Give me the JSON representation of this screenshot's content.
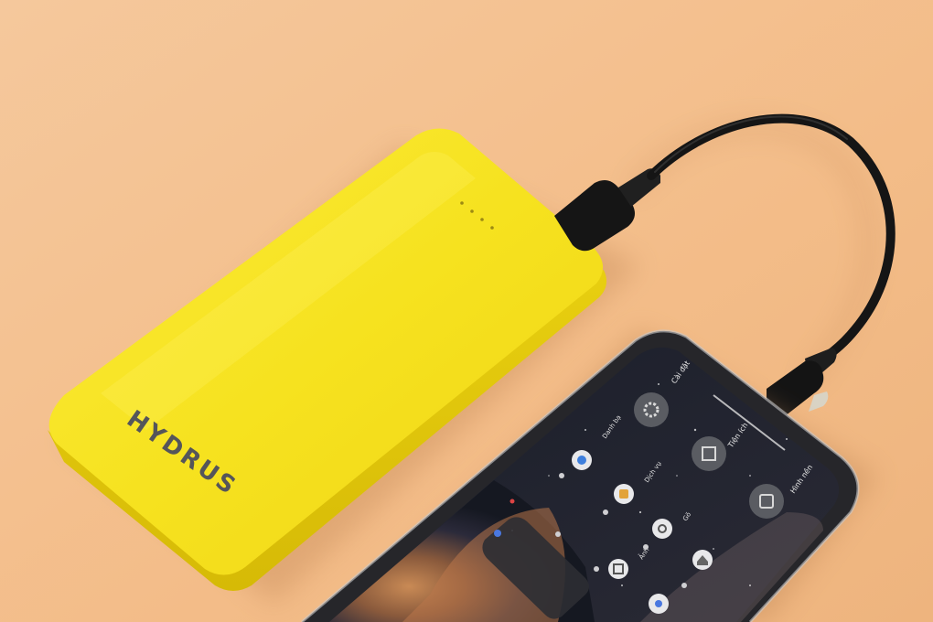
{
  "powerbank": {
    "brand": "HYDRUS",
    "color": "#f6e51f",
    "led_count": 4
  },
  "phone": {
    "apps": [
      {
        "label": "Cài đặt",
        "icon": "settings-icon"
      },
      {
        "label": "Tiện ích",
        "icon": "grid-icon"
      },
      {
        "label": "Hình nền",
        "icon": "wallpaper-icon"
      },
      {
        "label": "Danh bạ",
        "icon": "contacts-icon"
      },
      {
        "label": "Dịch vụ",
        "icon": "services-icon"
      },
      {
        "label": "Gõ",
        "icon": "type-icon"
      },
      {
        "label": "Ảnh",
        "icon": "photos-icon"
      }
    ]
  },
  "colors": {
    "background": "#f3be8c",
    "cable": "#141414",
    "phone_frame": "#1c1c1e"
  }
}
